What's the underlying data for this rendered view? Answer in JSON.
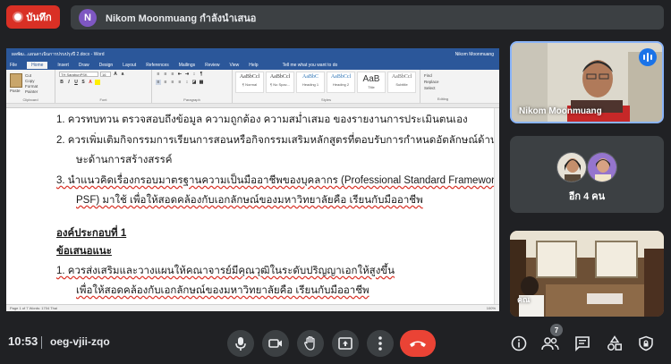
{
  "record_button": {
    "label": "บันทึก"
  },
  "presenter": {
    "initial": "N",
    "text": "Nikom Moonmuang กำลังนำเสนอ"
  },
  "word": {
    "title": "ผลพัฒ...แผนดาเนินการปรบปรุงปี 2.docx - Word",
    "user": "Nikom Moonmuang",
    "tabs": [
      "File",
      "Home",
      "Insert",
      "Draw",
      "Design",
      "Layout",
      "References",
      "Mailings",
      "Review",
      "View",
      "Help"
    ],
    "tell_me": "Tell me what you want to do",
    "paste_label": "Paste",
    "cut_label": "Cut",
    "copy_label": "Copy",
    "format_painter": "Format Painter",
    "font_name": "TH SarabunPSK",
    "font_size": "16",
    "clipboard_group": "Clipboard",
    "font_group": "Font",
    "paragraph_group": "Paragraph",
    "styles_group": "Styles",
    "editing_group": "Editing",
    "styles": [
      {
        "preview": "AaBbCcl",
        "label": "¶ Normal"
      },
      {
        "preview": "AaBbCcl",
        "label": "¶ No Spac..."
      },
      {
        "preview": "AaBbC",
        "label": "Heading 1"
      },
      {
        "preview": "AaBbCcl",
        "label": "Heading 2"
      },
      {
        "preview": "AaB",
        "label": "Title"
      },
      {
        "preview": "AaBbCcl",
        "label": "Subtitle"
      }
    ],
    "editing": [
      "Find",
      "Replace",
      "Select"
    ],
    "status_left": "Page 1 of 7    Words: 1704    Thai",
    "status_right": "100%"
  },
  "document": {
    "line1": "1.   ควรทบทวน ตรวจสอบถึงข้อมูล ความถูกต้อง ความสม่ำเสมอ ของรายงานการประเมินตนเอง",
    "line2": "2.   ควรเพิ่มเติมกิจกรรมการเรียนการสอนหรือกิจกรรมเสริมหลักสูตรที่ตอบรับการกำหนดอัตลักษณ์ด้านทัก",
    "line3": "ษะด้านการสร้างสรรค์",
    "line4": "3.   นำแนวคิดเรื่องกรอบมาตรฐานความเป็นมืออาชีพของบุคลากร (Professional Standard Framework:",
    "line5": "PSF) มาใช้ เพื่อให้สอดคล้องกับเอกลักษณ์ของมหาวิทยาลัยคือ เรียนกับมืออาชีพ",
    "heading1": "องค์ประกอบที่  1",
    "heading2": "ข้อเสนอแนะ",
    "line6": "1.   ควรส่งเสริมและวางแผนให้คณาจารย์มีคุณวุฒิในระดับปริญญาเอกให้สูงขึ้น",
    "line7": "เพื่อให้สอดคล้องกับเอกลักษณ์ของมหาวิทยาลัยคือ เรียนกับมืออาชีพ"
  },
  "tiles": {
    "main_speaker": "Nikom Moonmuang",
    "more_label": "อีก 4 คน",
    "third_name": "คณ"
  },
  "bottom": {
    "time": "10:53",
    "meeting_code": "oeg-vjii-zqo",
    "participant_count": "7"
  },
  "colors": {
    "accent": "#8ab4f8",
    "end_call": "#ea4335",
    "record": "#d93025",
    "word_blue": "#2b579a"
  }
}
